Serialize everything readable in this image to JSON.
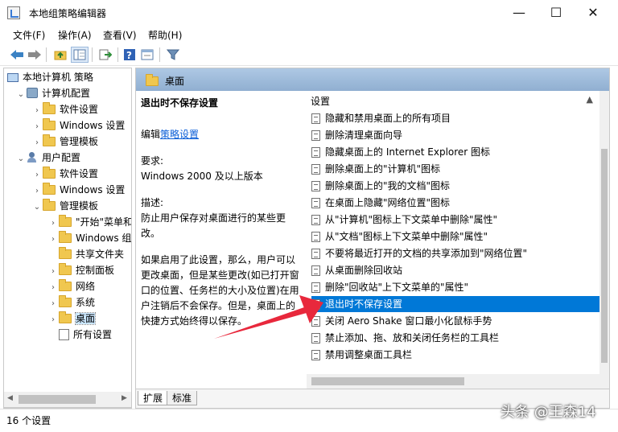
{
  "window": {
    "title": "本地组策略编辑器",
    "minimize": "—",
    "maximize": "☐",
    "close": "✕"
  },
  "menu": [
    "文件(F)",
    "操作(A)",
    "查看(V)",
    "帮助(H)"
  ],
  "toolbar_icons": [
    "back-icon",
    "forward-icon",
    "up-folder-icon",
    "show-hide-tree-icon",
    "export-list-icon",
    "help-icon",
    "properties-icon",
    "filter-icon"
  ],
  "tree": {
    "items": [
      {
        "label": "本地计算机 策略",
        "level": 0,
        "icon": "computer-policy-icon",
        "expand": ""
      },
      {
        "label": "计算机配置",
        "level": 1,
        "icon": "computer-config-icon",
        "expand": "v"
      },
      {
        "label": "软件设置",
        "level": 2,
        "icon": "folder-icon",
        "expand": ">"
      },
      {
        "label": "Windows 设置",
        "level": 2,
        "icon": "folder-icon",
        "expand": ">"
      },
      {
        "label": "管理模板",
        "level": 2,
        "icon": "folder-icon",
        "expand": ">"
      },
      {
        "label": "用户配置",
        "level": 1,
        "icon": "user-config-icon",
        "expand": "v"
      },
      {
        "label": "软件设置",
        "level": 2,
        "icon": "folder-icon",
        "expand": ">"
      },
      {
        "label": "Windows 设置",
        "level": 2,
        "icon": "folder-icon",
        "expand": ">"
      },
      {
        "label": "管理模板",
        "level": 2,
        "icon": "folder-icon",
        "expand": "v"
      },
      {
        "label": "\"开始\"菜单和",
        "level": 3,
        "icon": "folder-icon",
        "expand": ">"
      },
      {
        "label": "Windows 组",
        "level": 3,
        "icon": "folder-icon",
        "expand": ">"
      },
      {
        "label": "共享文件夹",
        "level": 3,
        "icon": "folder-icon",
        "expand": ""
      },
      {
        "label": "控制面板",
        "level": 3,
        "icon": "folder-icon",
        "expand": ">"
      },
      {
        "label": "网络",
        "level": 3,
        "icon": "folder-icon",
        "expand": ">"
      },
      {
        "label": "系统",
        "level": 3,
        "icon": "folder-icon",
        "expand": ">"
      },
      {
        "label": "桌面",
        "level": 3,
        "icon": "folder-icon",
        "expand": ">",
        "selected": true
      },
      {
        "label": "所有设置",
        "level": 3,
        "icon": "all-settings-icon",
        "expand": ""
      }
    ]
  },
  "right": {
    "header": "桌面",
    "desc": {
      "title": "退出时不保存设置",
      "edit_prefix": "编辑",
      "edit_link": "策略设置",
      "req_label": "要求:",
      "req_value": "Windows 2000 及以上版本",
      "desc_label": "描述:",
      "desc_text": "防止用户保存对桌面进行的某些更改。",
      "desc_more": "如果启用了此设置，那么，用户可以更改桌面，但是某些更改(如已打开窗口的位置、任务栏的大小及位置)在用户注销后不会保存。但是，桌面上的快捷方式始终得以保存。"
    },
    "list_header": "设置",
    "items": [
      "隐藏和禁用桌面上的所有项目",
      "删除清理桌面向导",
      "隐藏桌面上的 Internet Explorer 图标",
      "删除桌面上的\"计算机\"图标",
      "删除桌面上的\"我的文档\"图标",
      "在桌面上隐藏\"网络位置\"图标",
      "从\"计算机\"图标上下文菜单中删除\"属性\"",
      "从\"文档\"图标上下文菜单中删除\"属性\"",
      "不要将最近打开的文档的共享添加到\"网络位置\"",
      "从桌面删除回收站",
      "删除\"回收站\"上下文菜单的\"属性\"",
      "退出时不保存设置",
      "关闭 Aero Shake 窗口最小化鼠标手势",
      "禁止添加、拖、放和关闭任务栏的工具栏",
      "禁用调整桌面工具栏"
    ],
    "selected_index": 11,
    "tabs": [
      "扩展",
      "标准"
    ]
  },
  "status": {
    "count": "16 个设置"
  },
  "watermark": "头条 @王森14",
  "colors": {
    "selection": "#0078d7",
    "header": "#9bb8da",
    "arrow": "#e8283c"
  }
}
